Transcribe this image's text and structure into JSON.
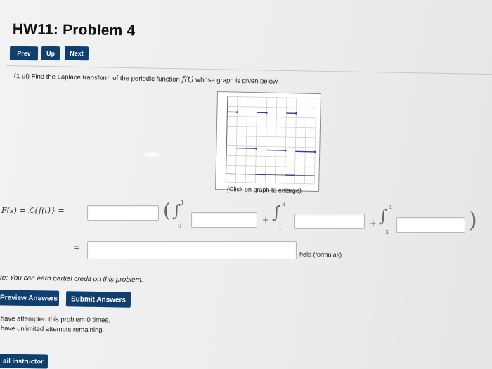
{
  "page_title": "HW11: Problem 4",
  "nav": {
    "prev": "Prev",
    "up": "Up",
    "next": "Next"
  },
  "problem": {
    "points": "(1 pt)",
    "text_before": "Find the Laplace transform of the periodic function",
    "func": "f(t)",
    "text_after": "whose graph is given below."
  },
  "graph": {
    "caption": "(Click on graph to enlarge)"
  },
  "answer": {
    "lhs": "F(s) = ℒ{f(t)} =",
    "equals": "=",
    "integral_lower": [
      "0",
      "1",
      "3"
    ],
    "integral_upper": [
      "1",
      "3",
      "4"
    ],
    "help_link": "help (formulas)"
  },
  "note": "te: You can earn partial credit on this problem.",
  "buttons": {
    "preview": "Preview Answers",
    "submit": "Submit Answers"
  },
  "status": {
    "attempted": "have attempted this problem 0 times.",
    "remaining": "have unlimited attempts remaining."
  },
  "email": "ail instructor"
}
